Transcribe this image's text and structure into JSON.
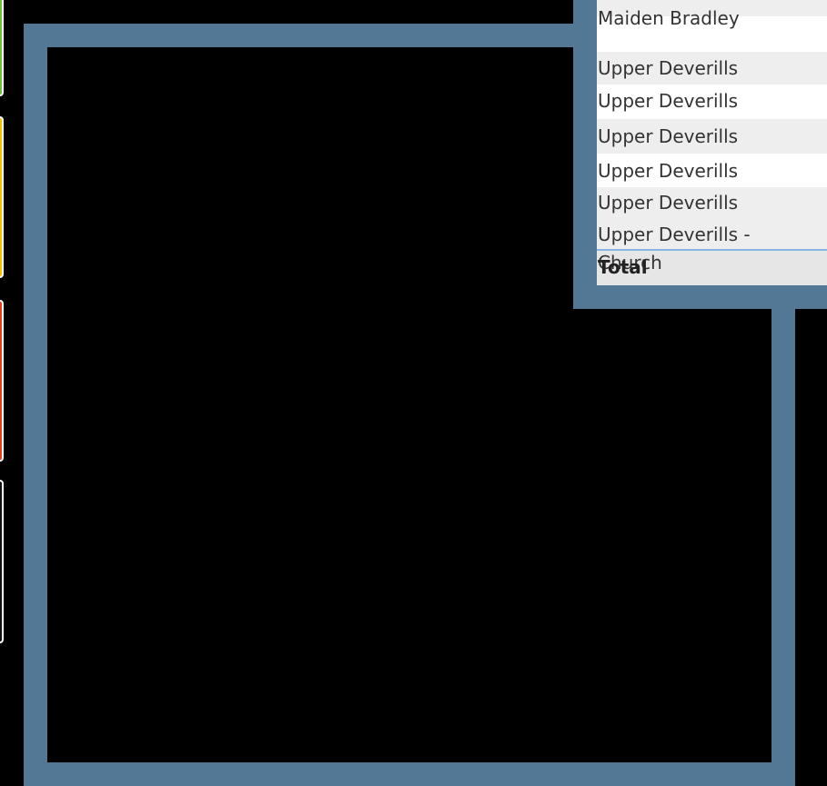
{
  "colors": {
    "background": "#000000",
    "frame": "#537896",
    "row_alt": "#eeeeee",
    "row_white": "#ffffff",
    "total_row": "#e6e6e6",
    "accent_line": "#8ab4e8",
    "tile_green": "#6bbf3a",
    "tile_yellow": "#f2c400",
    "tile_red": "#e0401a",
    "tile_dark": "#111111"
  },
  "table": {
    "rows": [
      "Maiden Bradley",
      "Upper Deverills",
      "Upper Deverills",
      "Upper Deverills",
      "Upper Deverills",
      "Upper Deverills",
      "Upper Deverills -\nChurch"
    ],
    "total_label": "Total"
  }
}
